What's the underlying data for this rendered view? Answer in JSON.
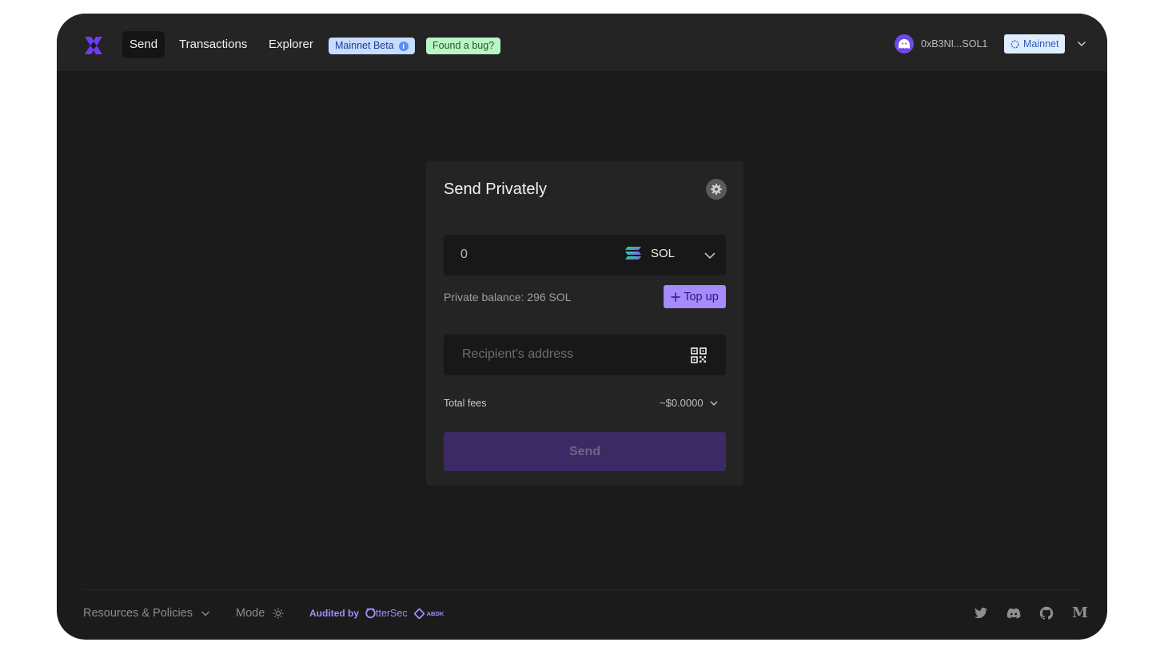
{
  "header": {
    "nav": [
      "Send",
      "Transactions",
      "Explorer"
    ],
    "beta_badge": "Mainnet Beta",
    "beta_info": "i",
    "bug_badge": "Found a bug?",
    "wallet": "0xB3NI...SOL1",
    "network": "Mainnet"
  },
  "card": {
    "title": "Send Privately",
    "amount": "0",
    "token": "SOL",
    "balance": "Private balance: 296 SOL",
    "topup_label": "Top up",
    "recipient_placeholder": "Recipient's address",
    "fees_label": "Total fees",
    "fees_value": "~$0.0000",
    "send_label": "Send"
  },
  "footer": {
    "resources": "Resources & Policies",
    "mode": "Mode",
    "audited_by": "Audited by",
    "otter_text": "tterSec",
    "abdk": "ABDK",
    "medium": "M"
  },
  "colors": {
    "accent": "#a58bfb",
    "send_disabled": "#3b2a63",
    "background": "#1b1b1b"
  },
  "icons": [
    "logo-icon",
    "info-icon",
    "wallet-ghost-icon",
    "network-icon",
    "chevron-down-icon",
    "gear-icon",
    "solana-icon",
    "plus-icon",
    "qr-code-icon",
    "sun-icon",
    "otter-icon",
    "abdk-icon",
    "twitter-icon",
    "discord-icon",
    "github-icon",
    "medium-icon"
  ]
}
